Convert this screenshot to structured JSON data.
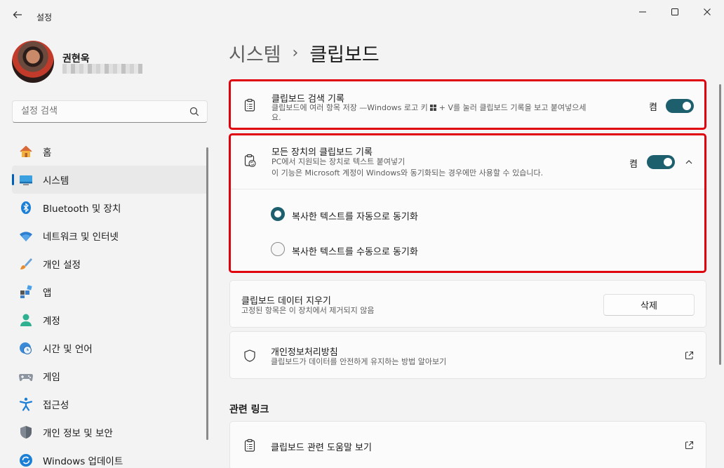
{
  "titlebar": {
    "app_title": "설정"
  },
  "user": {
    "name": "권현욱"
  },
  "search": {
    "placeholder": "설정 검색"
  },
  "sidebar": {
    "items": [
      {
        "label": "홈",
        "icon": "home-icon"
      },
      {
        "label": "시스템",
        "icon": "system-icon",
        "active": true
      },
      {
        "label": "Bluetooth 및 장치",
        "icon": "bluetooth-icon"
      },
      {
        "label": "네트워크 및 인터넷",
        "icon": "wifi-icon"
      },
      {
        "label": "개인 설정",
        "icon": "brush-icon"
      },
      {
        "label": "앱",
        "icon": "apps-icon"
      },
      {
        "label": "계정",
        "icon": "account-icon"
      },
      {
        "label": "시간 및 언어",
        "icon": "clock-globe-icon"
      },
      {
        "label": "게임",
        "icon": "gamepad-icon"
      },
      {
        "label": "접근성",
        "icon": "accessibility-icon"
      },
      {
        "label": "개인 정보 및 보안",
        "icon": "shield-icon"
      },
      {
        "label": "Windows 업데이트",
        "icon": "update-icon"
      }
    ]
  },
  "breadcrumb": {
    "parent": "시스템",
    "separator": "›",
    "current": "클립보드"
  },
  "clipboard_history": {
    "title": "클립보드 검색 기록",
    "desc_before": "클립보드에 여러 항목 저장 —Windows 로고 키 ",
    "desc_after": " + V를 눌러 클립보드 기록을 보고 붙여넣으세",
    "desc_line2": "요.",
    "toggle_label": "켬"
  },
  "sync": {
    "title": "모든 장치의 클립보드 기록",
    "desc1": "PC에서 지원되는 장치로 텍스트 붙여넣기",
    "desc2": "이 기능은 Microsoft 계정이 Windows와 동기화되는 경우에만 사용할 수 있습니다.",
    "toggle_label": "켬",
    "option_auto": "복사한 텍스트를 자동으로 동기화",
    "option_manual": "복사한 텍스트를 수동으로 동기화"
  },
  "clear": {
    "title": "클립보드 데이터 지우기",
    "desc": "고정된 항목은 이 장치에서 제거되지 않음",
    "button": "삭제"
  },
  "privacy": {
    "title": "개인정보처리방침",
    "desc": "클립보드가 데이터를 안전하게 유지하는 방법 알아보기"
  },
  "related": {
    "section_title": "관련 링크",
    "help_link": "클립보드 관련 도움말 보기"
  },
  "colors": {
    "accent": "#1e5f6e",
    "highlight": "#e0000d",
    "active_indicator": "#005fb8"
  }
}
